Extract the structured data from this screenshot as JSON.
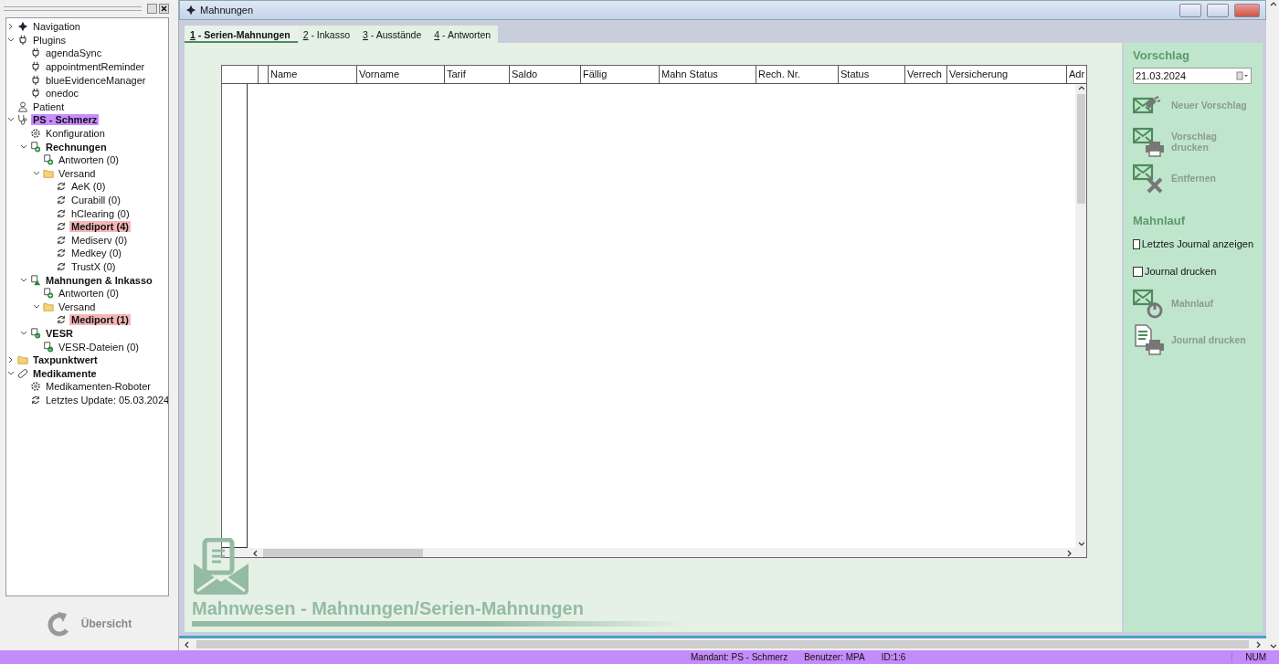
{
  "sidebar": {
    "tree": [
      {
        "label": "Navigation",
        "kind": "nav",
        "expanded": false
      },
      {
        "label": "Plugins",
        "kind": "plug",
        "expanded": true,
        "children": [
          {
            "label": "agendaSync",
            "kind": "plug"
          },
          {
            "label": "appointmentReminder",
            "kind": "plug"
          },
          {
            "label": "blueEvidenceManager",
            "kind": "plug"
          },
          {
            "label": "onedoc",
            "kind": "plug"
          }
        ]
      },
      {
        "label": "Patient",
        "kind": "person"
      },
      {
        "label": "PS - Schmerz",
        "kind": "stetho",
        "bold": true,
        "color": "#c98bff",
        "expanded": true,
        "children": [
          {
            "label": "Konfiguration",
            "kind": "gear"
          },
          {
            "label": "Rechnungen",
            "kind": "docplus",
            "bold": true,
            "expanded": true,
            "children": [
              {
                "label": "Antworten (0)",
                "kind": "docplus"
              },
              {
                "label": "Versand",
                "kind": "folder",
                "expanded": true,
                "children": [
                  {
                    "label": "AeK (0)",
                    "kind": "sync"
                  },
                  {
                    "label": "Curabill (0)",
                    "kind": "sync"
                  },
                  {
                    "label": "hClearing (0)",
                    "kind": "sync"
                  },
                  {
                    "label": "Mediport (4)",
                    "kind": "sync",
                    "bold": true,
                    "color": "#f4b6b6"
                  },
                  {
                    "label": "Mediserv (0)",
                    "kind": "sync"
                  },
                  {
                    "label": "Medkey (0)",
                    "kind": "sync"
                  },
                  {
                    "label": "TrustX (0)",
                    "kind": "sync"
                  }
                ]
              }
            ]
          },
          {
            "label": "Mahnungen & Inkasso",
            "kind": "docwarn",
            "bold": true,
            "expanded": true,
            "children": [
              {
                "label": "Antworten (0)",
                "kind": "docplus"
              },
              {
                "label": "Versand",
                "kind": "folder",
                "expanded": true,
                "children": [
                  {
                    "label": "Mediport (1)",
                    "kind": "sync",
                    "bold": true,
                    "color": "#f4b6b6"
                  }
                ]
              }
            ]
          },
          {
            "label": "VESR",
            "kind": "doccheck",
            "bold": true,
            "expanded": true,
            "children": [
              {
                "label": "VESR-Dateien (0)",
                "kind": "doccheck"
              }
            ]
          }
        ]
      },
      {
        "label": "Taxpunktwert",
        "kind": "folder",
        "bold": true,
        "expanded": false
      },
      {
        "label": "Medikamente",
        "kind": "pill",
        "bold": true,
        "expanded": true,
        "children": [
          {
            "label": "Medikamenten-Roboter",
            "kind": "gear"
          },
          {
            "label": "Letztes Update: 05.03.2024",
            "kind": "sync"
          }
        ]
      }
    ],
    "overview_button": "Übersicht"
  },
  "window": {
    "title": "Mahnungen"
  },
  "tabs": [
    {
      "key": "1",
      "label": " - Serien-Mahnungen",
      "selected": true
    },
    {
      "key": "2",
      "label": " - Inkasso",
      "selected": false
    },
    {
      "key": "3",
      "label": " - Ausstände",
      "selected": false
    },
    {
      "key": "4",
      "label": " - Antworten",
      "selected": false
    }
  ],
  "table": {
    "columns": [
      "Name",
      "Vorname",
      "Tarif",
      "Saldo",
      "Fällig",
      "Mahn Status",
      "Rech. Nr.",
      "Status",
      "Verrech",
      "Versicherung",
      "Adr"
    ]
  },
  "banner": "Mahnwesen - Mahnungen/Serien-Mahnungen",
  "panel": {
    "sections": [
      {
        "title": "Vorschlag",
        "date": "21.03.2024",
        "actions": [
          {
            "label": "Neuer Vorschlag",
            "kind": "new"
          },
          {
            "label": "Vorschlag drucken",
            "kind": "print"
          },
          {
            "label": "Entfernen",
            "kind": "remove"
          }
        ]
      },
      {
        "title": "Mahnlauf",
        "checkboxes": [
          {
            "label": "Letztes Journal anzeigen",
            "checked": false
          },
          {
            "label": "Journal drucken",
            "checked": false
          }
        ],
        "actions": [
          {
            "label": "Mahnlauf",
            "kind": "run"
          },
          {
            "label": "Journal drucken",
            "kind": "journal"
          }
        ]
      }
    ]
  },
  "status_bar": {
    "items": [
      "Mandant: PS - Schmerz",
      "Benutzer: MPA",
      "ID:1:6"
    ],
    "num": "NUM"
  }
}
